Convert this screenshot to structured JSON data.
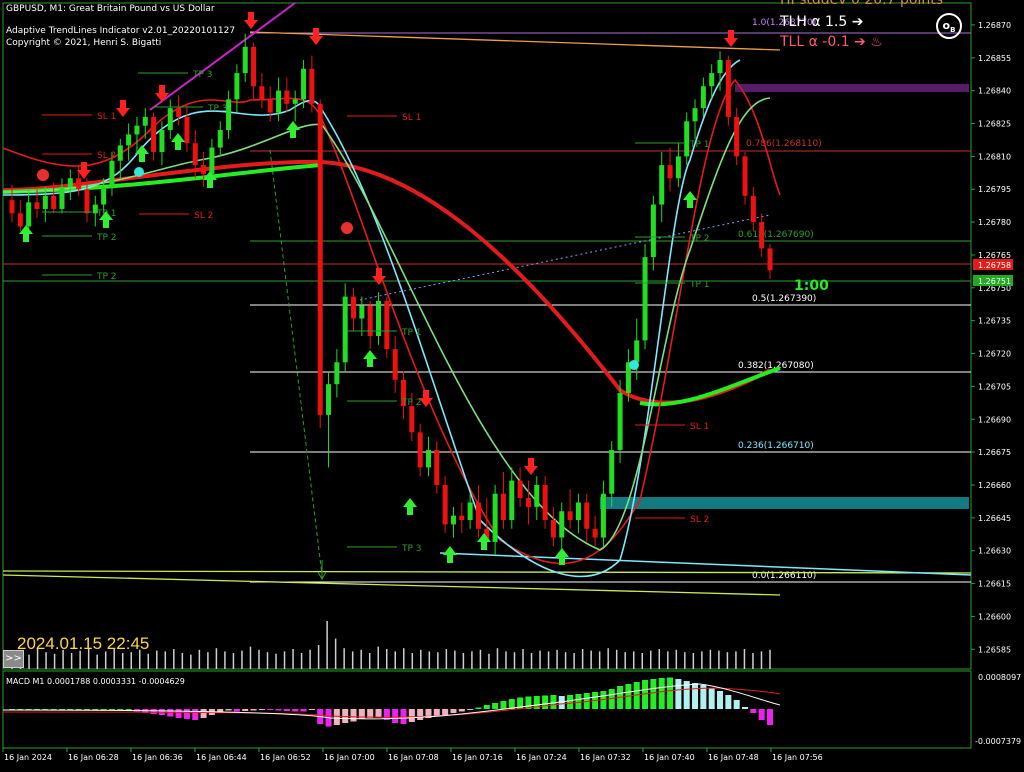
{
  "header": {
    "symbol_line": "GBPUSD, M1:  Great Britain Pound vs US Dollar",
    "indicator_line": "Adaptive TrendLines Indicator v2.01_20220101127",
    "copyright_line": "Copyright © 2021, Henri S. Bigatti"
  },
  "overlay": {
    "top_partial": "HI stddev 0 20.7 points",
    "tlh_label": "TLH α 1.5  ➔",
    "tll_label": "TLL α -0.1  ➔ ♨",
    "timestamp": "2024.01.15 22:45",
    "scroll_button": ">>",
    "countdown": "1:00",
    "logo_glyph": "o",
    "logo_sub": "B"
  },
  "colors": {
    "bull_candle": "#22dd22",
    "bear_candle": "#ee1111",
    "axis": "#2ca02c",
    "fast_line": "#7fe8ff",
    "slow_line": "#22ee22",
    "trend_line": "#e41b1b",
    "hline_red": "#c8302a",
    "teal_band": "#127a80",
    "purple_band": "#5a1a6a",
    "tlh_color": "#ffffff",
    "tll_color": "#ff5a6a"
  },
  "chart_data": {
    "type": "candlestick",
    "symbol": "GBPUSD",
    "timeframe": "M1",
    "price_axis": {
      "ticks": [
        "1.26870",
        "1.26855",
        "1.26840",
        "1.26825",
        "1.26810",
        "1.26795",
        "1.26780",
        "1.26765",
        "1.26750",
        "1.26735",
        "1.26720",
        "1.26705",
        "1.26690",
        "1.26675",
        "1.26660",
        "1.26645",
        "1.26630",
        "1.26615",
        "1.26600",
        "1.26585"
      ],
      "ylim": [
        1.26576,
        1.2688
      ],
      "bid_label": "1.26758",
      "ask_label": "1.26751"
    },
    "time_axis": {
      "ticks": [
        "16 Jan 2024",
        "16 Jan 06:28",
        "16 Jan 06:36",
        "16 Jan 06:44",
        "16 Jan 06:52",
        "16 Jan 07:00",
        "16 Jan 07:08",
        "16 Jan 07:16",
        "16 Jan 07:24",
        "16 Jan 07:32",
        "16 Jan 07:40",
        "16 Jan 07:48",
        "16 Jan 07:56"
      ]
    },
    "candles": [
      [
        1.2679,
        1.26797,
        1.2678,
        1.26784
      ],
      [
        1.26784,
        1.2679,
        1.26776,
        1.26778
      ],
      [
        1.26778,
        1.26795,
        1.26775,
        1.26789
      ],
      [
        1.26789,
        1.26795,
        1.26782,
        1.26786
      ],
      [
        1.26786,
        1.26796,
        1.2678,
        1.26792
      ],
      [
        1.26792,
        1.26798,
        1.26784,
        1.26786
      ],
      [
        1.26786,
        1.268,
        1.26784,
        1.26796
      ],
      [
        1.26796,
        1.26804,
        1.2679,
        1.268
      ],
      [
        1.268,
        1.26806,
        1.26792,
        1.26795
      ],
      [
        1.26795,
        1.268,
        1.2678,
        1.26784
      ],
      [
        1.26784,
        1.26792,
        1.26778,
        1.26788
      ],
      [
        1.26788,
        1.268,
        1.26784,
        1.26796
      ],
      [
        1.26796,
        1.26812,
        1.26792,
        1.26808
      ],
      [
        1.26808,
        1.26818,
        1.268,
        1.26815
      ],
      [
        1.26815,
        1.26825,
        1.26808,
        1.2682
      ],
      [
        1.2682,
        1.26828,
        1.26812,
        1.26824
      ],
      [
        1.26824,
        1.26832,
        1.26818,
        1.26828
      ],
      [
        1.26828,
        1.2683,
        1.26808,
        1.26812
      ],
      [
        1.26812,
        1.26826,
        1.26806,
        1.26822
      ],
      [
        1.26822,
        1.26836,
        1.26818,
        1.26832
      ],
      [
        1.26832,
        1.26838,
        1.26824,
        1.26828
      ],
      [
        1.26828,
        1.26834,
        1.26812,
        1.26816
      ],
      [
        1.26816,
        1.26822,
        1.268,
        1.26806
      ],
      [
        1.26806,
        1.26812,
        1.26796,
        1.26802
      ],
      [
        1.26802,
        1.26818,
        1.26798,
        1.26814
      ],
      [
        1.26814,
        1.26826,
        1.2681,
        1.26822
      ],
      [
        1.26822,
        1.2684,
        1.26818,
        1.26836
      ],
      [
        1.26836,
        1.26852,
        1.2683,
        1.26848
      ],
      [
        1.26848,
        1.26866,
        1.26844,
        1.2686
      ],
      [
        1.2686,
        1.26862,
        1.26836,
        1.26842
      ],
      [
        1.26842,
        1.26848,
        1.26832,
        1.26836
      ],
      [
        1.26836,
        1.26842,
        1.26826,
        1.2683
      ],
      [
        1.2683,
        1.26846,
        1.26826,
        1.2684
      ],
      [
        1.2684,
        1.26846,
        1.2683,
        1.26834
      ],
      [
        1.26834,
        1.2684,
        1.26826,
        1.26836
      ],
      [
        1.26836,
        1.26854,
        1.26832,
        1.2685
      ],
      [
        1.2685,
        1.26856,
        1.2683,
        1.26834
      ],
      [
        1.26834,
        1.26836,
        1.26686,
        1.26692
      ],
      [
        1.26692,
        1.26712,
        1.26668,
        1.26706
      ],
      [
        1.26706,
        1.26722,
        1.267,
        1.26716
      ],
      [
        1.26716,
        1.26752,
        1.26712,
        1.26746
      ],
      [
        1.26746,
        1.2675,
        1.2673,
        1.26736
      ],
      [
        1.26736,
        1.26746,
        1.26728,
        1.26742
      ],
      [
        1.26742,
        1.26744,
        1.26722,
        1.26728
      ],
      [
        1.26728,
        1.26748,
        1.26724,
        1.26744
      ],
      [
        1.26744,
        1.26746,
        1.26718,
        1.26722
      ],
      [
        1.26722,
        1.26728,
        1.26702,
        1.26708
      ],
      [
        1.26708,
        1.26712,
        1.2669,
        1.26696
      ],
      [
        1.26696,
        1.26702,
        1.2668,
        1.26684
      ],
      [
        1.26684,
        1.26688,
        1.26664,
        1.26668
      ],
      [
        1.26668,
        1.26682,
        1.26664,
        1.26676
      ],
      [
        1.26676,
        1.2668,
        1.26656,
        1.2666
      ],
      [
        1.2666,
        1.26664,
        1.26638,
        1.26642
      ],
      [
        1.26642,
        1.2665,
        1.26636,
        1.26646
      ],
      [
        1.26646,
        1.26652,
        1.26638,
        1.26644
      ],
      [
        1.26644,
        1.26656,
        1.2664,
        1.26652
      ],
      [
        1.26652,
        1.2666,
        1.26636,
        1.2664
      ],
      [
        1.2664,
        1.26654,
        1.2663,
        1.26634
      ],
      [
        1.26634,
        1.2666,
        1.26628,
        1.26656
      ],
      [
        1.26656,
        1.26666,
        1.2664,
        1.26644
      ],
      [
        1.26644,
        1.26668,
        1.2664,
        1.26662
      ],
      [
        1.26662,
        1.26668,
        1.2665,
        1.26654
      ],
      [
        1.26654,
        1.26662,
        1.26642,
        1.2665
      ],
      [
        1.2665,
        1.26664,
        1.26644,
        1.2666
      ],
      [
        1.2666,
        1.26664,
        1.2664,
        1.26644
      ],
      [
        1.26644,
        1.2665,
        1.26632,
        1.26636
      ],
      [
        1.26636,
        1.26652,
        1.2663,
        1.26648
      ],
      [
        1.26648,
        1.26658,
        1.2664,
        1.26644
      ],
      [
        1.26644,
        1.26656,
        1.26638,
        1.26652
      ],
      [
        1.26652,
        1.26656,
        1.26634,
        1.2664
      ],
      [
        1.2664,
        1.26646,
        1.26632,
        1.26636
      ],
      [
        1.26636,
        1.26662,
        1.26632,
        1.26656
      ],
      [
        1.26656,
        1.2668,
        1.2665,
        1.26676
      ],
      [
        1.26676,
        1.26708,
        1.2667,
        1.26702
      ],
      [
        1.26702,
        1.26722,
        1.26698,
        1.26716
      ],
      [
        1.26716,
        1.26736,
        1.26708,
        1.26726
      ],
      [
        1.26726,
        1.2677,
        1.26722,
        1.26764
      ],
      [
        1.26764,
        1.26792,
        1.26758,
        1.26788
      ],
      [
        1.26788,
        1.26812,
        1.2678,
        1.26806
      ],
      [
        1.26806,
        1.26814,
        1.26794,
        1.268
      ],
      [
        1.268,
        1.26816,
        1.26796,
        1.2681
      ],
      [
        1.2681,
        1.2683,
        1.26806,
        1.26826
      ],
      [
        1.26826,
        1.26836,
        1.26818,
        1.26832
      ],
      [
        1.26832,
        1.26846,
        1.26828,
        1.26842
      ],
      [
        1.26842,
        1.26852,
        1.26836,
        1.26848
      ],
      [
        1.26848,
        1.26858,
        1.2684,
        1.26854
      ],
      [
        1.26854,
        1.26856,
        1.26824,
        1.26828
      ],
      [
        1.26828,
        1.26832,
        1.26806,
        1.2681
      ],
      [
        1.2681,
        1.26812,
        1.26788,
        1.26792
      ],
      [
        1.26792,
        1.26796,
        1.26776,
        1.2678
      ],
      [
        1.2678,
        1.26784,
        1.26764,
        1.26768
      ],
      [
        1.26768,
        1.2677,
        1.26754,
        1.26758
      ]
    ],
    "fib_levels": [
      {
        "label": "1.0(1.268770)",
        "color": "#c586ff"
      },
      {
        "label": "0.786(1.268110)",
        "color": "#c8302a"
      },
      {
        "label": "0.618(1.267690)",
        "color": "#2ca02c"
      },
      {
        "label": "0.5(1.267390)",
        "color": "#ffffff"
      },
      {
        "label": "0.382(1.267080)",
        "color": "#ffffff"
      },
      {
        "label": "0.236(1.266710)",
        "color": "#7fe8ff"
      },
      {
        "label": "0.0(1.266110)",
        "color": "#ffffff"
      }
    ],
    "trade_labels": [
      {
        "text": "TP 3",
        "color": "#2ca02c"
      },
      {
        "text": "TP 2",
        "color": "#2ca02c"
      },
      {
        "text": "TP 1",
        "color": "#2ca02c"
      },
      {
        "text": "SL 1",
        "color": "#e41b1b"
      },
      {
        "text": "SL 2",
        "color": "#e41b1b"
      },
      {
        "text": "SL 1",
        "color": "#e41b1b"
      },
      {
        "text": "SL 2",
        "color": "#e41b1b"
      },
      {
        "text": "TP 1",
        "color": "#2ca02c"
      },
      {
        "text": "TP 2",
        "color": "#2ca02c"
      },
      {
        "text": "TP 3",
        "color": "#2ca02c"
      },
      {
        "text": "TP 1",
        "color": "#2ca02c"
      },
      {
        "text": "TP 2",
        "color": "#2ca02c"
      },
      {
        "text": "TP 1",
        "color": "#2ca02c"
      },
      {
        "text": "TP 2",
        "color": "#2ca02c"
      },
      {
        "text": "TP 3",
        "color": "#2ca02c"
      },
      {
        "text": "SL 1",
        "color": "#e41b1b"
      },
      {
        "text": "SL 2",
        "color": "#e41b1b"
      }
    ],
    "volume": [
      20,
      22,
      18,
      25,
      21,
      19,
      24,
      20,
      23,
      26,
      18,
      22,
      25,
      20,
      21,
      24,
      19,
      23,
      22,
      25,
      20,
      18,
      24,
      21,
      26,
      22,
      20,
      23,
      28,
      24,
      21,
      19,
      22,
      25,
      20,
      24,
      30,
      60,
      38,
      26,
      22,
      24,
      20,
      28,
      25,
      22,
      26,
      20,
      24,
      22,
      21,
      25,
      23,
      20,
      22,
      24,
      19,
      26,
      22,
      21,
      25,
      20,
      23,
      22,
      24,
      21,
      20,
      25,
      23,
      22,
      26,
      24,
      21,
      22,
      20,
      23,
      25,
      22,
      24,
      21,
      20,
      22,
      24,
      23,
      21,
      22,
      25,
      20,
      22,
      24
    ],
    "macd": {
      "label": "MACD M1 0.0001788 0.0003331 -0.0004629",
      "axis_top": "0.0008097",
      "axis_bottom": "-0.0007379",
      "histogram": [
        0,
        0,
        0,
        0,
        0,
        0,
        0,
        0,
        0,
        0,
        0,
        0,
        0,
        0,
        0,
        -0.5,
        -0.8,
        -1,
        -1.2,
        -1.5,
        -1.8,
        -2,
        -2.2,
        -1.8,
        -1.2,
        -0.5,
        -0.3,
        -0.5,
        -0.4,
        -0.3,
        -0.2,
        -0.2,
        -0.3,
        -0.4,
        -0.5,
        -0.5,
        -0.2,
        -3,
        -3.5,
        -3.2,
        -2.8,
        -2.5,
        -2,
        -1.8,
        -1.6,
        -2.2,
        -2.8,
        -3,
        -2.6,
        -2.2,
        -1.8,
        -1.5,
        -1.2,
        -0.8,
        -0.5,
        -0.2,
        0.3,
        0.8,
        1.2,
        1.6,
        2,
        2.3,
        2.5,
        2.6,
        2.7,
        2.8,
        2.6,
        2.8,
        3,
        3.2,
        3.4,
        3.6,
        4,
        4.6,
        5,
        5.4,
        5.8,
        6,
        6.2,
        6.3,
        6,
        5.6,
        5.2,
        4.8,
        4.2,
        3.6,
        2.8,
        1.8,
        0.4,
        -0.8,
        -2.2,
        -3.2
      ],
      "hist_colors": [
        "up_strong",
        "up_weak",
        "down_strong",
        "down_weak"
      ]
    }
  }
}
